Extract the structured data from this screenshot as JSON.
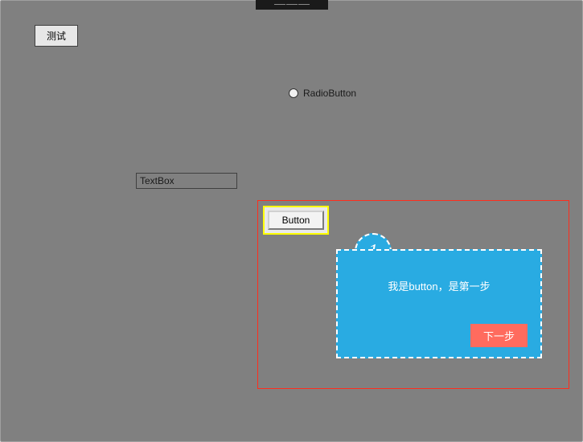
{
  "toolbar": {
    "test_label": "测试"
  },
  "radio": {
    "label": "RadioButton"
  },
  "textbox": {
    "value": "TextBox"
  },
  "highlighted": {
    "button_label": "Button"
  },
  "tour": {
    "step_number": "1",
    "message": "我是button，是第一步",
    "next_label": "下一步"
  }
}
